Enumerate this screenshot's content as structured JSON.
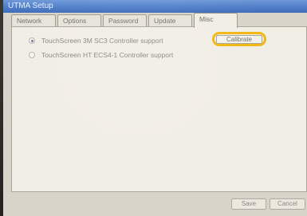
{
  "window": {
    "title": "UTMA Setup"
  },
  "tabs": [
    {
      "label": "Network",
      "active": false
    },
    {
      "label": "Options",
      "active": false
    },
    {
      "label": "Password",
      "active": false
    },
    {
      "label": "Update",
      "active": false
    },
    {
      "label": "Misc",
      "active": true
    }
  ],
  "misc": {
    "options": [
      {
        "label": "TouchScreen 3M SC3 Controller support",
        "selected": true
      },
      {
        "label": "TouchScreen HT ECS4-1 Controller support",
        "selected": false
      }
    ],
    "calibrate_label": "Calibrate",
    "highlight_color": "#f2b712"
  },
  "footer": {
    "save_label": "Save",
    "cancel_label": "Cancel"
  }
}
